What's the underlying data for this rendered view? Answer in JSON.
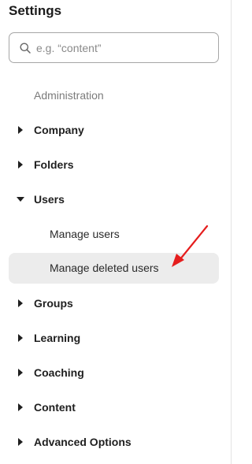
{
  "settings": {
    "title": "Settings"
  },
  "search": {
    "placeholder": "e.g. “content”",
    "value": ""
  },
  "section": {
    "administration": "Administration"
  },
  "nav": {
    "company": "Company",
    "folders": "Folders",
    "users": "Users",
    "manage_users": "Manage users",
    "manage_deleted_users": "Manage deleted users",
    "groups": "Groups",
    "learning": "Learning",
    "coaching": "Coaching",
    "content": "Content",
    "advanced_options": "Advanced Options"
  },
  "colors": {
    "active_background": "#ececec",
    "annotation_arrow": "#e51d1d"
  }
}
